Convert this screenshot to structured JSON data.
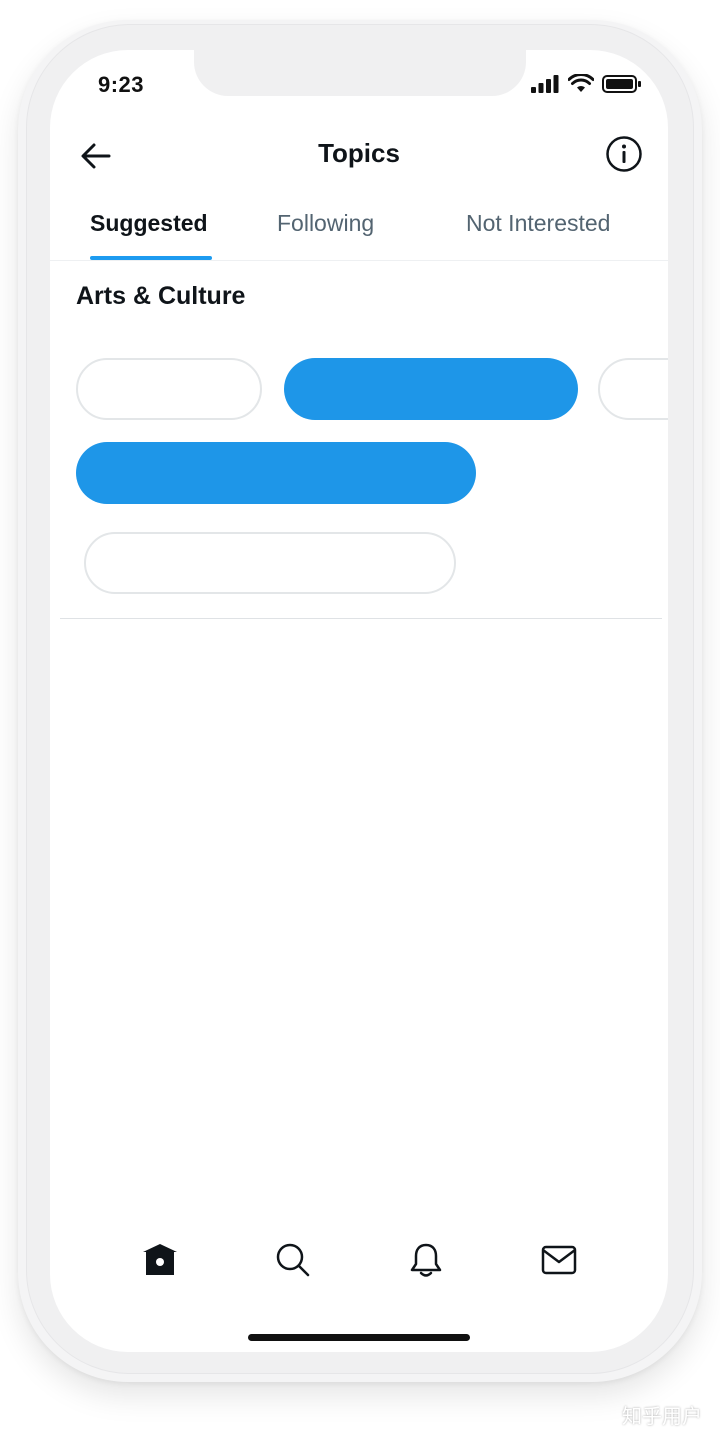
{
  "status_bar": {
    "time": "9:23"
  },
  "header": {
    "title": "Topics",
    "back_icon": "arrow-left-icon",
    "info_icon": "info-circle-icon"
  },
  "tabs": [
    {
      "label": "Suggested",
      "active": true
    },
    {
      "label": "Following",
      "active": false
    },
    {
      "label": "Not Interested",
      "active": false
    }
  ],
  "section": {
    "title": "Arts & Culture"
  },
  "bottom_nav": {
    "items": [
      "home-icon",
      "search-icon",
      "bell-icon",
      "mail-icon"
    ]
  },
  "watermark": "知乎用户",
  "colors": {
    "accent": "#1d9bf0",
    "chip_filled": "#1e96e8",
    "text_primary": "#0f1419",
    "text_secondary": "#536471"
  }
}
